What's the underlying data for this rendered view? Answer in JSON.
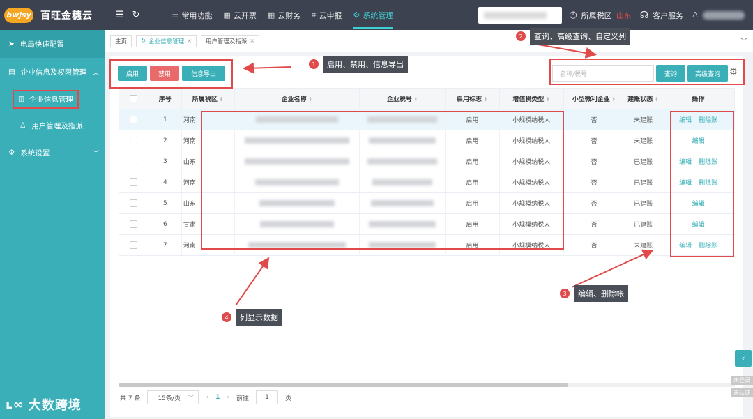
{
  "app": {
    "logo_badge": "bwjsy",
    "title": "百旺金穗云"
  },
  "topnav": {
    "items": [
      {
        "label": "常用功能",
        "icon": "sliders-icon"
      },
      {
        "label": "云开票",
        "icon": "grid-icon"
      },
      {
        "label": "云财务",
        "icon": "grid-icon"
      },
      {
        "label": "云申报",
        "icon": "crop-icon"
      },
      {
        "label": "系统管理",
        "icon": "gear-icon",
        "active": true
      }
    ],
    "tax_area_label": "所属税区",
    "tax_area_value": "山东",
    "customer_service": "客户服务"
  },
  "sidebar": {
    "items": [
      {
        "label": "电局快速配置"
      },
      {
        "label": "企业信息及权限管理"
      },
      {
        "label": "企业信息管理"
      },
      {
        "label": "用户管理及指派"
      },
      {
        "label": "系统设置"
      }
    ],
    "footer": "大数跨境"
  },
  "tabs": [
    {
      "label": "主页"
    },
    {
      "label": "企业信息管理",
      "active": true
    },
    {
      "label": "用户管理及指派"
    }
  ],
  "toolbar": {
    "enable": "启用",
    "disable": "禁用",
    "export": "信息导出",
    "search_placeholder": "名称/税号",
    "search": "查询",
    "advanced": "高级查询"
  },
  "table": {
    "headers": [
      "序号",
      "所属税区",
      "企业名称",
      "企业税号",
      "启用标志",
      "增值税类型",
      "小型微利企业",
      "建账状态",
      "操作"
    ],
    "rows": [
      {
        "no": "1",
        "area": "河南",
        "flag": "启用",
        "vat": "小规模纳税人",
        "small": "否",
        "status": "未建账",
        "ops": [
          "编辑",
          "删除账"
        ]
      },
      {
        "no": "2",
        "area": "河南",
        "flag": "启用",
        "vat": "小规模纳税人",
        "small": "否",
        "status": "未建账",
        "ops": [
          "编辑"
        ]
      },
      {
        "no": "3",
        "area": "山东",
        "flag": "启用",
        "vat": "小规模纳税人",
        "small": "否",
        "status": "已建账",
        "ops": [
          "编辑",
          "删除账"
        ]
      },
      {
        "no": "4",
        "area": "河南",
        "flag": "启用",
        "vat": "小规模纳税人",
        "small": "否",
        "status": "已建账",
        "ops": [
          "编辑",
          "删除账"
        ]
      },
      {
        "no": "5",
        "area": "山东",
        "flag": "启用",
        "vat": "小规模纳税人",
        "small": "否",
        "status": "已建账",
        "ops": [
          "编辑"
        ]
      },
      {
        "no": "6",
        "area": "甘肃",
        "flag": "启用",
        "vat": "小规模纳税人",
        "small": "否",
        "status": "已建账",
        "ops": [
          "编辑"
        ]
      },
      {
        "no": "7",
        "area": "河南",
        "flag": "启用",
        "vat": "小规模纳税人",
        "small": "否",
        "status": "未建账",
        "ops": [
          "编辑",
          "删除账"
        ]
      }
    ]
  },
  "pager": {
    "total": "共 7 条",
    "page_size": "15条/页",
    "current": "1",
    "goto_label": "前往",
    "goto_value": "1",
    "page_suffix": "页"
  },
  "annotations": [
    {
      "num": "1",
      "text": "启用、禁用、信息导出"
    },
    {
      "num": "2",
      "text": "查询、高级查询、自定义列"
    },
    {
      "num": "3",
      "text": "编辑、删除帐"
    },
    {
      "num": "4",
      "text": "列显示数据"
    }
  ],
  "side_badges": [
    "未登录",
    "未认证"
  ],
  "colors": {
    "accent": "#3aafb8",
    "topbar": "#3c4250",
    "annotation": "#e04a4a",
    "built": "#5dbb2a"
  }
}
